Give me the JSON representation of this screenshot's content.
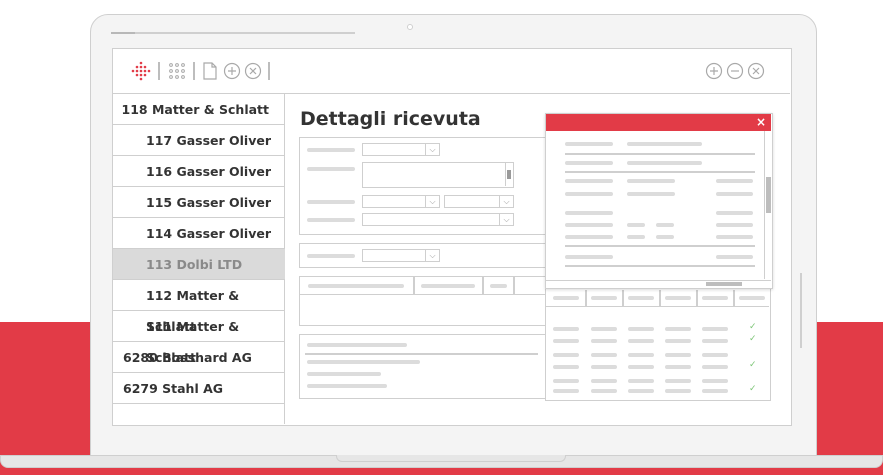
{
  "colors": {
    "brand_red": "#e23b47",
    "check_green": "#7cc576",
    "selected_row": "#dadada"
  },
  "toolbar": {
    "left_icons": [
      "logo-icon",
      "grid-icon",
      "new-document-icon",
      "add-icon",
      "close-icon"
    ],
    "right_icons": [
      "add-icon",
      "remove-icon",
      "close-icon"
    ]
  },
  "sidebar": {
    "items": [
      {
        "label": "118 Matter & Schlatt"
      },
      {
        "label": "117 Gasser Oliver"
      },
      {
        "label": "116 Gasser Oliver"
      },
      {
        "label": "115 Gasser Oliver"
      },
      {
        "label": "114 Gasser Oliver"
      },
      {
        "label": "113 Dolbi LTD",
        "selected": true
      },
      {
        "label": "112 Matter & Schlatt"
      },
      {
        "label": "111 Matter & Schlatt"
      },
      {
        "label": "6280 Bosshard AG"
      },
      {
        "label": "6279 Stahl AG"
      }
    ]
  },
  "main": {
    "title": "Dettagli ricevuta"
  },
  "popup": {
    "close_glyph": "×"
  }
}
